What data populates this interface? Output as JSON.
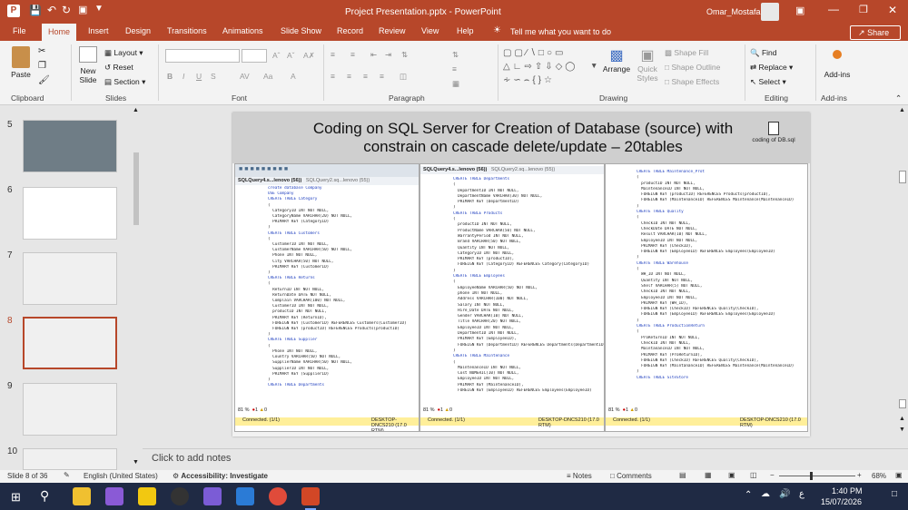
{
  "titlebar": {
    "title": "Project Presentation.pptx  -  PowerPoint",
    "user": "Omar_Mostafa"
  },
  "tabs": [
    "File",
    "Home",
    "Insert",
    "Design",
    "Transitions",
    "Animations",
    "Slide Show",
    "Record",
    "Review",
    "View",
    "Help"
  ],
  "tellme": "Tell me what you want to do",
  "share": "Share",
  "ribbon": {
    "paste": "Paste",
    "clipboard": "Clipboard",
    "new_slide": "New",
    "new_slide2": "Slide",
    "layout": "Layout",
    "reset": "Reset",
    "section": "Section",
    "slides": "Slides",
    "font": "Font",
    "paragraph": "Paragraph",
    "arrange": "Arrange",
    "quick": "Quick",
    "styles": "Styles",
    "shape_fill": "Shape Fill",
    "shape_outline": "Shape Outline",
    "shape_effects": "Shape Effects",
    "drawing": "Drawing",
    "find": "Find",
    "replace": "Replace",
    "select": "Select",
    "editing": "Editing",
    "addins": "Add-ins",
    "addins_group": "Add-ins"
  },
  "thumbs": [
    {
      "num": "5"
    },
    {
      "num": "6"
    },
    {
      "num": "7"
    },
    {
      "num": "8"
    },
    {
      "num": "9"
    },
    {
      "num": "10"
    }
  ],
  "slide": {
    "title_line1": "Coding on SQL Server for Creation of Database (source) with",
    "title_line2": "constrain on cascade delete/update – 20tables",
    "file_label": "coding of DB.sql"
  },
  "sql": {
    "tab1": "SQLQuery4.s...lenovo (56))",
    "tab1b": "SQLQuery2.sq...lenovo (55))",
    "tab2": "SQLQuery4.s...lenovo (56))",
    "tab2b": "SQLQuery2.sq...lenovo (55))",
    "zoom": "81 %",
    "connected": "Connected. (1/1)",
    "server": "DESKTOP-DNCS210 (17.0 RTM)",
    "pane1": [
      "create database Company",
      "USE Company",
      "",
      "CREATE TABLE Category",
      "(",
      "  CategoryID INT NOT NULL,",
      "  CategoryName VARCHAR(20) NOT NULL,",
      "  PRIMARY KEY (CategoryID)",
      ")",
      "CREATE TABLE Customers",
      "(",
      "  CustomerID INT NOT NULL,",
      "  CustomerName VARCHAR(50) NOT NULL,",
      "  Phone INT NOT NULL,",
      "  City VARCHAR(50) NOT NULL,",
      "  PRIMARY KEY (CustomerID)",
      ")",
      "CREATE TABLE Returns",
      "(",
      "  ReturnID INT NOT NULL,",
      "  ReturnDate DATE NOT NULL,",
      "  Complain VARCHAR(100) NOT NULL,",
      "  CustomerID INT NOT NULL,",
      "  productID INT NOT NULL,",
      "  PRIMARY KEY (ReturnID),",
      "  FOREIGN KEY (CustomerID) REFERENCES Customers(CustomerID)",
      "  FOREIGN KEY (productID) REFERENCES Products(productID)",
      ")",
      "CREATE TABLE Supplier",
      "(",
      "  Phone INT NOT NULL,",
      "  Country VARCHAR(50) NOT NULL,",
      "  SupplierName VARCHAR(50) NOT NULL,",
      "  SupplierID INT NOT NULL,",
      "  PRIMARY KEY (SupplierID)",
      ")",
      "CREATE TABLE Departments"
    ],
    "pane2": [
      "CREATE TABLE Departments",
      "(",
      "  DepartmentID INT NOT NULL,",
      "  DepartmentName VARCHAR(30) NOT NULL,",
      "  PRIMARY KEY (DepartmentID)",
      ")",
      "CREATE TABLE Products",
      "(",
      "  productID INT NOT NULL,",
      "  ProductName VARCHAR(50) NOT NULL,",
      "  WarrantyPeriod INT NOT NULL,",
      "  Brand VARCHAR(50) NOT NULL,",
      "  Quantity INT NOT NULL,",
      "  CategoryID INT NOT NULL,",
      "  PRIMARY KEY (productID),",
      "  FOREIGN KEY (CategoryID) REFERENCES Category(CategoryID)",
      ")",
      "CREATE TABLE Employees",
      "(",
      "  EmployeeName VARCHAR(50) NOT NULL,",
      "  phone INT NOT NULL,",
      "  Address VARCHAR(100) NOT NULL,",
      "  Salary INT NOT NULL,",
      "  Hire_Date DATE NOT NULL,",
      "  Gender VARCHAR(10) NOT NULL,",
      "  Title VARCHAR(20) NOT NULL,",
      "  EmployeeID INT NOT NULL,",
      "  DepartmentID INT NOT NULL,",
      "  PRIMARY KEY (EmployeeID),",
      "  FOREIGN KEY (DepartmentID) REFERENCES Departments(DepartmentID)",
      ")",
      "CREATE TABLE Maintenance",
      "(",
      "  MaintenanceID INT NOT NULL,",
      "  Cost NUMERIC(10) NOT NULL,",
      "  EmployeeID INT NOT NULL,",
      "  PRIMARY KEY (MaintenanceID),",
      "  FOREIGN KEY (EmployeeID) REFERENCES Employees(EmployeeID)"
    ],
    "pane3": [
      "CREATE TABLE Maintenance_Prot",
      "(",
      "  productID INT NOT NULL,",
      "  MaintenanceID INT NOT NULL,",
      "  FOREIGN KEY (productID) REFERENCES Products(productID),",
      "  FOREIGN KEY (MaintenanceID) REFERENCES Maintenance(MaintenanceID)",
      ")",
      "CREATE TABLE Quality",
      "(",
      "  CheckID INT NOT NULL,",
      "  CheckDate DATE NOT NULL,",
      "  Result VARCHAR(10) NOT NULL,",
      "  EmployeeID INT NOT NULL,",
      "  PRIMARY KEY (CheckID),",
      "  FOREIGN KEY (EmployeeID) REFERENCES Employees(EmployeeID)",
      ")",
      "CREATE TABLE Warehouse",
      "(",
      "  WH_ID INT NOT NULL,",
      "  Quantity INT NOT NULL,",
      "  Shelf VARCHAR(5) NOT NULL,",
      "  CheckID INT NOT NULL,",
      "  EmployeeID INT NOT NULL,",
      "  PRIMARY KEY (WH_ID),",
      "  FOREIGN KEY (CheckID) REFERENCES Quality(CheckID),",
      "  FOREIGN KEY (EmployeeID) REFERENCES Employees(EmployeeID)",
      ")",
      "CREATE TABLE ProductionReturn",
      "(",
      "  ProReturnID INT NOT NULL,",
      "  CheckID INT NOT NULL,",
      "  MaintananceID INT NOT NULL,",
      "  PRIMARY KEY (ProReturnID),",
      "  FOREIGN KEY (CheckID) REFERENCES Quality(CheckID),",
      "  FOREIGN KEY (MaintananceID) REFERENCES Maintenance(MaintenanceID)",
      ")",
      "CREATE TABLE SiteStore"
    ]
  },
  "notes": "Click to add notes",
  "status": {
    "slide": "Slide 8 of 36",
    "lang": "English (United States)",
    "access": "Accessibility: Investigate",
    "notes": "Notes",
    "comments": "Comments",
    "zoom": "68%"
  },
  "taskbar": {
    "time": "1:40 PM",
    "date": "15/07/2026",
    "lang": "ع"
  }
}
